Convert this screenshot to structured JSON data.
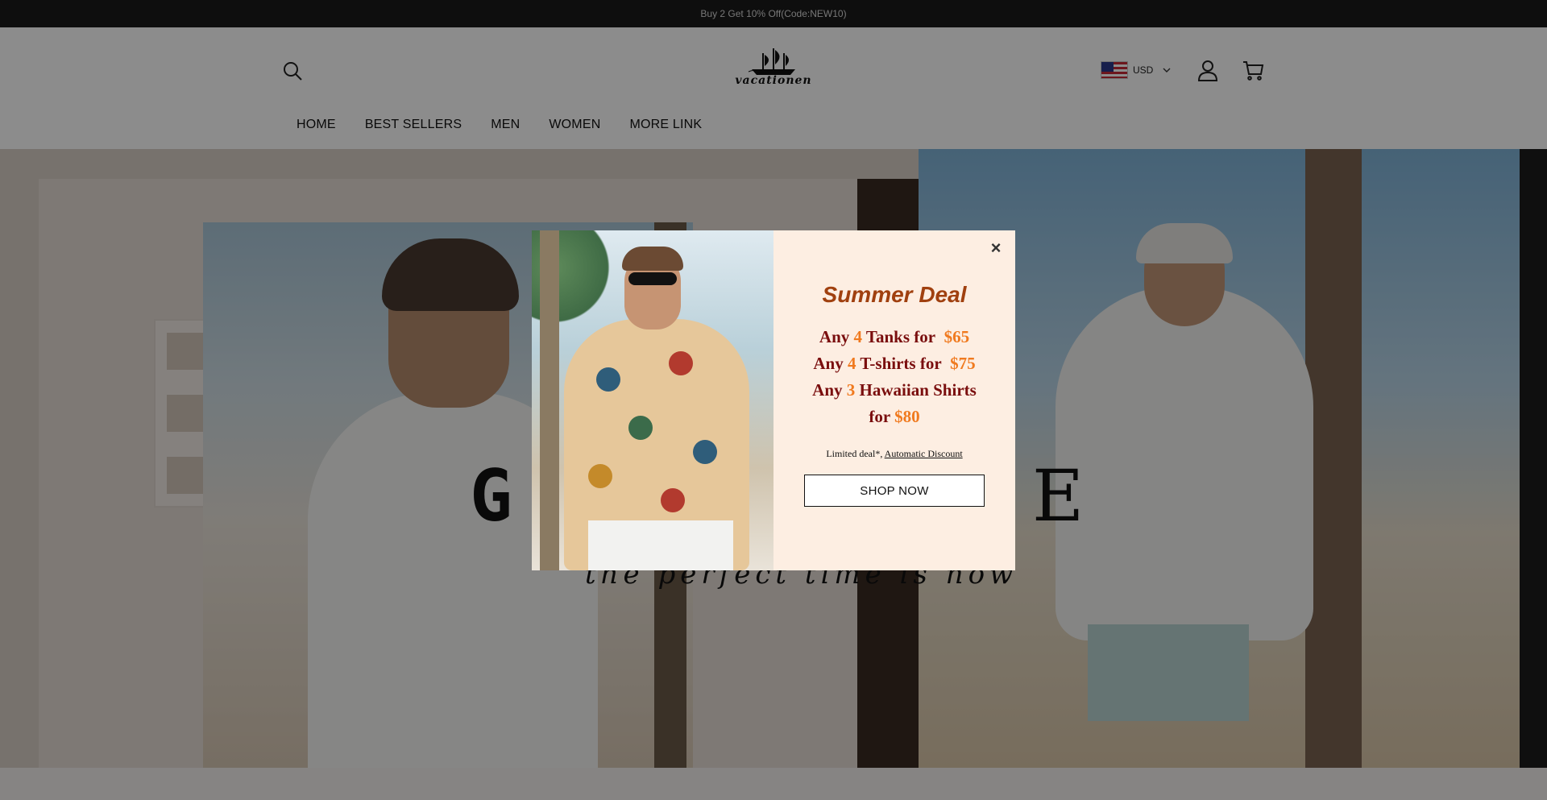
{
  "announcement": {
    "text": "Buy 2 Get 10% Off(Code:NEW10)"
  },
  "header": {
    "logo_text": "vacationen",
    "currency": {
      "code": "USD",
      "flag": "us-flag-icon"
    },
    "icons": {
      "search": "search-icon",
      "account": "user-icon",
      "cart": "cart-icon"
    }
  },
  "nav": {
    "items": [
      {
        "label": "HOME"
      },
      {
        "label": "BEST SELLERS"
      },
      {
        "label": "MEN"
      },
      {
        "label": "WOMEN"
      },
      {
        "label": "MORE LINK"
      }
    ]
  },
  "hero": {
    "letter_left": "G",
    "letter_right": "E",
    "tagline": "the perfect time is now"
  },
  "popup": {
    "title": "Summer Deal",
    "offers": [
      {
        "prefix": "Any",
        "qty": "4",
        "item": "Tanks for",
        "price": "$65"
      },
      {
        "prefix": "Any",
        "qty": "4",
        "item": "T-shirts for",
        "price": "$75"
      },
      {
        "prefix": "Any",
        "qty": "3",
        "item": "Hawaiian Shirts for",
        "price": "$80"
      }
    ],
    "limited_text": "Limited deal*,",
    "limited_link": "Automatic Discount",
    "cta": "SHOP NOW",
    "close_symbol": "×"
  },
  "colors": {
    "announcement_bg": "#1a1a1a",
    "popup_bg": "#fdeee2",
    "title_color": "#a0400f",
    "offer_text": "#7a0e0e",
    "offer_accent": "#f07a1f"
  }
}
